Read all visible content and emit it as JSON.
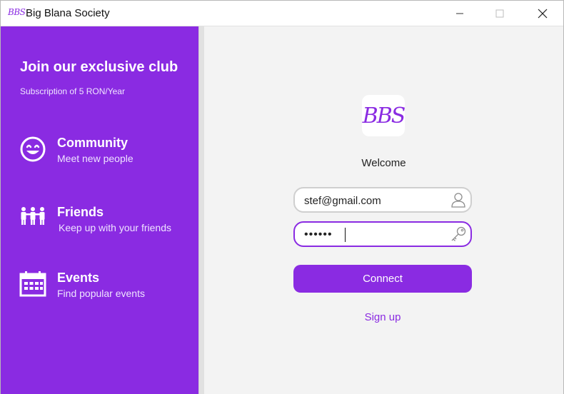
{
  "window": {
    "logo_text": "BBS",
    "title": "Big Blana Society",
    "controls": [
      "minimize-icon",
      "maximize-icon",
      "close-icon"
    ]
  },
  "sidebar": {
    "title": "Join our exclusive club",
    "subtitle": "Subscription of 5 RON/Year",
    "features": [
      {
        "icon": "smiley-icon",
        "title": "Community",
        "description": "Meet new people"
      },
      {
        "icon": "people-group-icon",
        "title": "Friends",
        "description": "Keep up with your friends"
      },
      {
        "icon": "calendar-icon",
        "title": "Events",
        "description": "Find popular events"
      }
    ]
  },
  "login": {
    "logo_text": "BBS",
    "welcome": "Welcome",
    "email_value": "stef@gmail.com",
    "password_value": "••••••",
    "connect_label": "Connect",
    "signup_label": "Sign up"
  },
  "colors": {
    "accent": "#8a2be2",
    "panel_background": "#f3f3f3",
    "titlebar_background": "#ffffff"
  }
}
